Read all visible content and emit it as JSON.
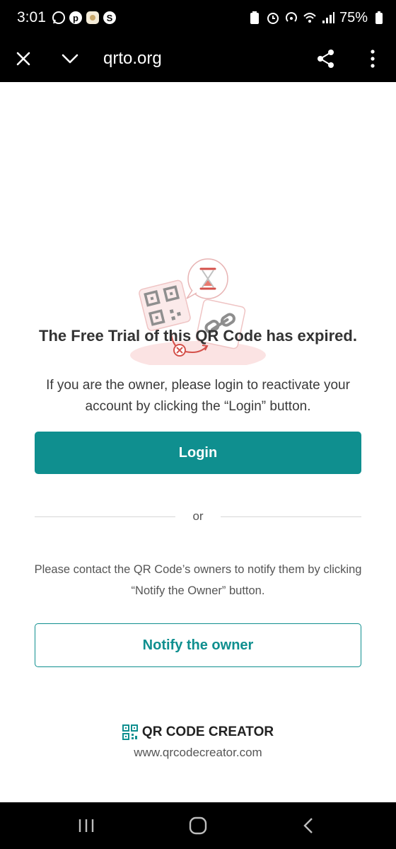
{
  "status_bar": {
    "time": "3:01",
    "battery_percent": "75%",
    "left_icons": [
      "whatsapp-icon",
      "pinterest-icon",
      "app-icon",
      "s-app-icon"
    ],
    "right_icons": [
      "battery-saver-icon",
      "alarm-icon",
      "hotspot-icon",
      "wifi-icon",
      "signal-icon",
      "battery-icon"
    ]
  },
  "browser": {
    "url": "qrto.org"
  },
  "main": {
    "headline": "The Free Trial of this QR Code has expired.",
    "owner_message": "If you are the owner, please login to reactivate your account by clicking the “Login” button.",
    "login_label": "Login",
    "divider_text": "or",
    "contact_message": "Please contact the QR Code’s owners to notify them by clicking “Notify the Owner” button.",
    "notify_label": "Notify the owner"
  },
  "brand": {
    "name": "QR CODE CREATOR",
    "url": "www.qrcodecreator.com"
  },
  "colors": {
    "accent": "#0f8f8f",
    "bars": "#000000"
  }
}
